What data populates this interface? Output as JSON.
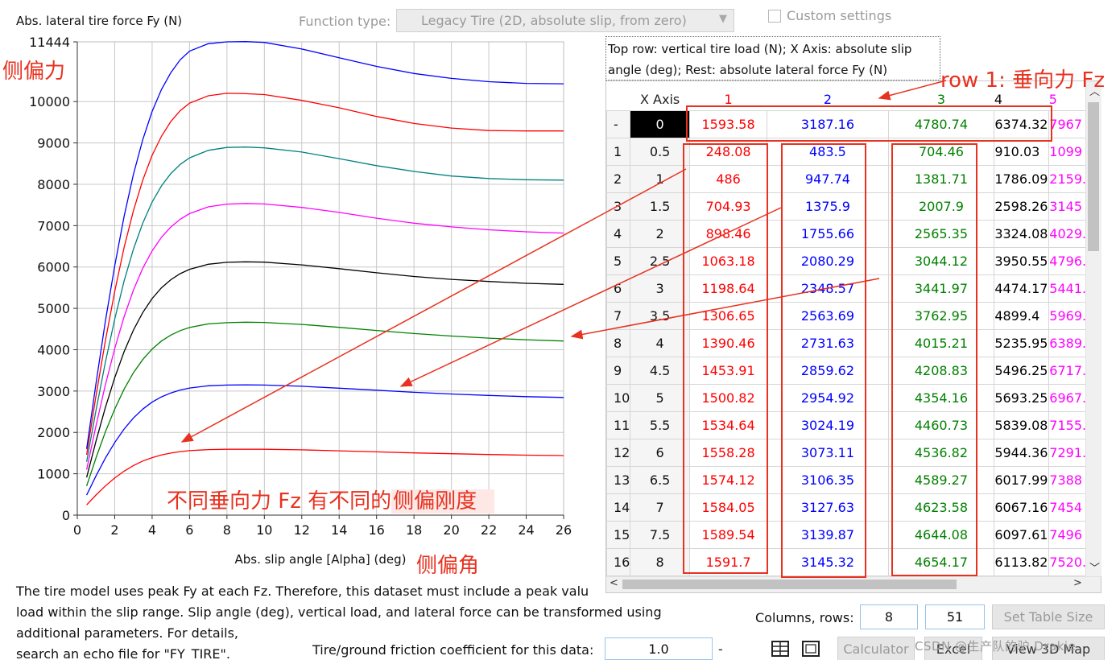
{
  "header": {
    "chart_title": "Abs. lateral tire force Fy (N)",
    "function_type_label": "Function type:",
    "function_type_value": "Legacy Tire (2D, absolute slip, from zero)",
    "custom_settings_label": "Custom settings"
  },
  "chart_data": {
    "type": "line",
    "title": "Abs. lateral tire force Fy (N)",
    "xlabel": "Abs. slip angle [Alpha] (deg)",
    "ylabel": "",
    "xlim": [
      0,
      26
    ],
    "ylim": [
      0,
      11444
    ],
    "x_ticks": [
      "0",
      "2",
      "4",
      "6",
      "8",
      "10",
      "12",
      "14",
      "16",
      "18",
      "20",
      "22",
      "24",
      "26"
    ],
    "y_ticks": [
      "0",
      "1000",
      "2000",
      "3000",
      "4000",
      "5000",
      "6000",
      "7000",
      "8000",
      "9000",
      "10000",
      "11444"
    ],
    "grid": true,
    "series": [
      {
        "color": "#ff0000",
        "points": [
          [
            0.5,
            248
          ],
          [
            1,
            486
          ],
          [
            1.5,
            705
          ],
          [
            2,
            898
          ],
          [
            2.5,
            1063
          ],
          [
            3,
            1199
          ],
          [
            3.5,
            1307
          ],
          [
            4,
            1390
          ],
          [
            4.5,
            1454
          ],
          [
            5,
            1501
          ],
          [
            5.5,
            1535
          ],
          [
            6,
            1558
          ],
          [
            7,
            1584
          ],
          [
            8,
            1592
          ],
          [
            9,
            1593
          ],
          [
            10,
            1592
          ],
          [
            12,
            1578
          ],
          [
            14,
            1555
          ],
          [
            16,
            1530
          ],
          [
            18,
            1505
          ],
          [
            20,
            1485
          ],
          [
            22,
            1465
          ],
          [
            24,
            1450
          ],
          [
            26,
            1440
          ]
        ]
      },
      {
        "color": "#0000ff",
        "points": [
          [
            0.5,
            484
          ],
          [
            1,
            948
          ],
          [
            1.5,
            1376
          ],
          [
            2,
            1756
          ],
          [
            2.5,
            2080
          ],
          [
            3,
            2349
          ],
          [
            3.5,
            2564
          ],
          [
            4,
            2732
          ],
          [
            4.5,
            2860
          ],
          [
            5,
            2955
          ],
          [
            5.5,
            3024
          ],
          [
            6,
            3073
          ],
          [
            7,
            3128
          ],
          [
            8,
            3145
          ],
          [
            9,
            3150
          ],
          [
            10,
            3145
          ],
          [
            12,
            3115
          ],
          [
            14,
            3070
          ],
          [
            16,
            3020
          ],
          [
            18,
            2970
          ],
          [
            20,
            2930
          ],
          [
            22,
            2895
          ],
          [
            24,
            2865
          ],
          [
            26,
            2845
          ]
        ]
      },
      {
        "color": "#008000",
        "points": [
          [
            0.5,
            704
          ],
          [
            1,
            1382
          ],
          [
            1.5,
            2008
          ],
          [
            2,
            2565
          ],
          [
            2.5,
            3044
          ],
          [
            3,
            3442
          ],
          [
            3.5,
            3763
          ],
          [
            4,
            4015
          ],
          [
            4.5,
            4209
          ],
          [
            5,
            4354
          ],
          [
            5.5,
            4461
          ],
          [
            6,
            4537
          ],
          [
            7,
            4624
          ],
          [
            8,
            4654
          ],
          [
            9,
            4665
          ],
          [
            10,
            4660
          ],
          [
            12,
            4610
          ],
          [
            14,
            4540
          ],
          [
            16,
            4465
          ],
          [
            18,
            4390
          ],
          [
            20,
            4330
          ],
          [
            22,
            4280
          ],
          [
            24,
            4240
          ],
          [
            26,
            4210
          ]
        ]
      },
      {
        "color": "#000000",
        "points": [
          [
            0.5,
            910
          ],
          [
            1,
            1786
          ],
          [
            1.5,
            2598
          ],
          [
            2,
            3324
          ],
          [
            2.5,
            3951
          ],
          [
            3,
            4474
          ],
          [
            3.5,
            4899
          ],
          [
            4,
            5236
          ],
          [
            4.5,
            5496
          ],
          [
            5,
            5693
          ],
          [
            5.5,
            5839
          ],
          [
            6,
            5944
          ],
          [
            7,
            6067
          ],
          [
            8,
            6114
          ],
          [
            9,
            6125
          ],
          [
            10,
            6118
          ],
          [
            12,
            6050
          ],
          [
            14,
            5960
          ],
          [
            16,
            5860
          ],
          [
            18,
            5770
          ],
          [
            20,
            5700
          ],
          [
            22,
            5650
          ],
          [
            24,
            5605
          ],
          [
            26,
            5580
          ]
        ]
      },
      {
        "color": "#ff00ff",
        "points": [
          [
            0.5,
            1100
          ],
          [
            1,
            2159
          ],
          [
            1.5,
            3145
          ],
          [
            2,
            4029
          ],
          [
            2.5,
            4796
          ],
          [
            3,
            5441
          ],
          [
            3.5,
            5969
          ],
          [
            4,
            6389
          ],
          [
            4.5,
            6717
          ],
          [
            5,
            6967
          ],
          [
            5.5,
            7155
          ],
          [
            6,
            7291
          ],
          [
            7,
            7454
          ],
          [
            8,
            7520
          ],
          [
            9,
            7535
          ],
          [
            10,
            7525
          ],
          [
            12,
            7440
          ],
          [
            14,
            7320
          ],
          [
            16,
            7180
          ],
          [
            18,
            7060
          ],
          [
            20,
            6970
          ],
          [
            22,
            6900
          ],
          [
            24,
            6850
          ],
          [
            26,
            6820
          ]
        ]
      },
      {
        "color": "#008080",
        "points": [
          [
            0.5,
            1290
          ],
          [
            1,
            2530
          ],
          [
            1.5,
            3690
          ],
          [
            2,
            4740
          ],
          [
            2.5,
            5660
          ],
          [
            3,
            6430
          ],
          [
            3.5,
            7060
          ],
          [
            4,
            7570
          ],
          [
            4.5,
            7960
          ],
          [
            5,
            8260
          ],
          [
            5.5,
            8480
          ],
          [
            6,
            8640
          ],
          [
            7,
            8820
          ],
          [
            8,
            8890
          ],
          [
            9,
            8900
          ],
          [
            10,
            8880
          ],
          [
            12,
            8780
          ],
          [
            14,
            8620
          ],
          [
            16,
            8450
          ],
          [
            18,
            8310
          ],
          [
            20,
            8200
          ],
          [
            22,
            8140
          ],
          [
            24,
            8110
          ],
          [
            26,
            8100
          ]
        ]
      },
      {
        "color": "#ff0000",
        "points": [
          [
            0.5,
            1460
          ],
          [
            1,
            2880
          ],
          [
            1.5,
            4210
          ],
          [
            2,
            5410
          ],
          [
            2.5,
            6470
          ],
          [
            3,
            7360
          ],
          [
            3.5,
            8100
          ],
          [
            4,
            8700
          ],
          [
            4.5,
            9160
          ],
          [
            5,
            9520
          ],
          [
            5.5,
            9780
          ],
          [
            6,
            9960
          ],
          [
            7,
            10140
          ],
          [
            8,
            10200
          ],
          [
            9,
            10190
          ],
          [
            10,
            10170
          ],
          [
            12,
            10030
          ],
          [
            14,
            9850
          ],
          [
            16,
            9640
          ],
          [
            18,
            9470
          ],
          [
            20,
            9360
          ],
          [
            22,
            9300
          ],
          [
            24,
            9290
          ],
          [
            26,
            9290
          ]
        ]
      },
      {
        "color": "#0000ff",
        "points": [
          [
            0.5,
            1600
          ],
          [
            1,
            3180
          ],
          [
            1.5,
            4680
          ],
          [
            2,
            6030
          ],
          [
            2.5,
            7220
          ],
          [
            3,
            8240
          ],
          [
            3.5,
            9080
          ],
          [
            4,
            9760
          ],
          [
            4.5,
            10290
          ],
          [
            5,
            10700
          ],
          [
            5.5,
            11010
          ],
          [
            6,
            11220
          ],
          [
            7,
            11400
          ],
          [
            8,
            11444
          ],
          [
            9,
            11450
          ],
          [
            10,
            11430
          ],
          [
            12,
            11270
          ],
          [
            14,
            11060
          ],
          [
            16,
            10850
          ],
          [
            18,
            10680
          ],
          [
            20,
            10560
          ],
          [
            22,
            10480
          ],
          [
            24,
            10440
          ],
          [
            26,
            10430
          ]
        ]
      }
    ]
  },
  "hint": {
    "line1": "Top row: vertical tire load (N); X Axis: absolute slip",
    "line2": "angle (deg); Rest: absolute lateral force Fy (N)"
  },
  "table": {
    "xaxis_header": "X Axis",
    "col_headers": [
      "1",
      "2",
      "3",
      "4",
      "5"
    ],
    "col_colors": [
      "#ff0000",
      "#0000ff",
      "#008000",
      "#000000",
      "#ff00ff"
    ],
    "load_row": {
      "label": "-",
      "x": "0",
      "vals": [
        "1593.58",
        "3187.16",
        "4780.74",
        "6374.32",
        "7967"
      ]
    },
    "rows": [
      {
        "n": "1",
        "x": "0.5",
        "vals": [
          "248.08",
          "483.5",
          "704.46",
          "910.03",
          "1099"
        ]
      },
      {
        "n": "2",
        "x": "1",
        "vals": [
          "486",
          "947.74",
          "1381.71",
          "1786.09",
          "2159."
        ]
      },
      {
        "n": "3",
        "x": "1.5",
        "vals": [
          "704.93",
          "1375.9",
          "2007.9",
          "2598.26",
          "3145"
        ]
      },
      {
        "n": "4",
        "x": "2",
        "vals": [
          "898.46",
          "1755.66",
          "2565.35",
          "3324.08",
          "4029."
        ]
      },
      {
        "n": "5",
        "x": "2.5",
        "vals": [
          "1063.18",
          "2080.29",
          "3044.12",
          "3950.55",
          "4796."
        ]
      },
      {
        "n": "6",
        "x": "3",
        "vals": [
          "1198.64",
          "2348.57",
          "3441.97",
          "4474.17",
          "5441."
        ]
      },
      {
        "n": "7",
        "x": "3.5",
        "vals": [
          "1306.65",
          "2563.69",
          "3762.95",
          "4899.4",
          "5969."
        ]
      },
      {
        "n": "8",
        "x": "4",
        "vals": [
          "1390.46",
          "2731.63",
          "4015.21",
          "5235.95",
          "6389."
        ]
      },
      {
        "n": "9",
        "x": "4.5",
        "vals": [
          "1453.91",
          "2859.62",
          "4208.83",
          "5496.25",
          "6717."
        ]
      },
      {
        "n": "10",
        "x": "5",
        "vals": [
          "1500.82",
          "2954.92",
          "4354.16",
          "5693.25",
          "6967."
        ]
      },
      {
        "n": "11",
        "x": "5.5",
        "vals": [
          "1534.64",
          "3024.19",
          "4460.73",
          "5839.08",
          "7155."
        ]
      },
      {
        "n": "12",
        "x": "6",
        "vals": [
          "1558.28",
          "3073.11",
          "4536.82",
          "5944.36",
          "7291."
        ]
      },
      {
        "n": "13",
        "x": "6.5",
        "vals": [
          "1574.12",
          "3106.35",
          "4589.27",
          "6017.99",
          "7388"
        ]
      },
      {
        "n": "14",
        "x": "7",
        "vals": [
          "1584.05",
          "3127.63",
          "4623.58",
          "6067.16",
          "7454"
        ]
      },
      {
        "n": "15",
        "x": "7.5",
        "vals": [
          "1589.54",
          "3139.87",
          "4644.08",
          "6097.61",
          "7496"
        ]
      },
      {
        "n": "16",
        "x": "8",
        "vals": [
          "1591.7",
          "3145.32",
          "4654.17",
          "6113.82",
          "7520."
        ]
      }
    ]
  },
  "description": {
    "line1": "The tire model uses peak Fy at each Fz. Therefore, this dataset must include a peak valu",
    "line2": "load within the slip range. Slip angle (deg), vertical load, and lateral force can be transformed using",
    "line3": "additional parameters. For details,",
    "line4": "search an echo file for \"FY_TIRE\"."
  },
  "friction": {
    "label": "Tire/ground friction coefficient for this data:",
    "value": "1.0",
    "dash": "-"
  },
  "size_controls": {
    "label": "Columns, rows:",
    "columns": "8",
    "rows": "51",
    "set_table_size": "Set Table Size",
    "calculator": "Calculator",
    "excel": "Excel",
    "view_3d_map": "View 3D Map"
  },
  "annotations": {
    "lateral_force": "侧偏力",
    "row1": "row 1: 垂向力 Fz",
    "stiffness_note": "不同垂向力 Fz 有不同的",
    "stiffness_highlight": "侧偏刚度",
    "slip_angle": "侧偏角",
    "color": "#e8311f"
  },
  "watermark": "CSDN @生产队的驴 Drakie"
}
